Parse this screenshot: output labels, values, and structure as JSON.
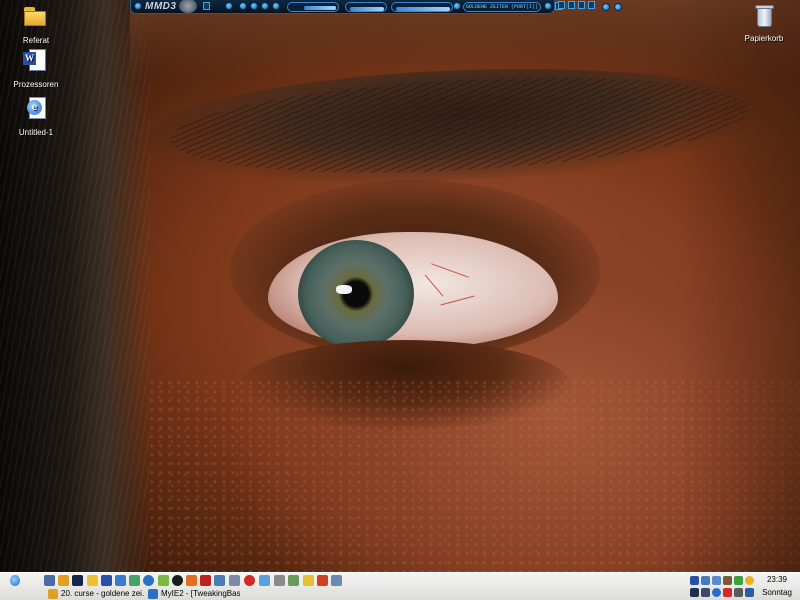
{
  "desktop": {
    "icons": [
      {
        "label": "Referat",
        "icon": "folder-icon"
      },
      {
        "label": "Prozessoren",
        "icon": "word-document-icon"
      },
      {
        "label": "Untitled-1",
        "icon": "html-document-icon"
      },
      {
        "label": "Papierkorb",
        "icon": "recycle-bin-icon"
      }
    ]
  },
  "media_player": {
    "logo": "MMD",
    "logo_number": "3",
    "track_display": "GOLDENE ZEITEN (PORT(I))",
    "accent_color": "#3d86c8"
  },
  "taskbar": {
    "start_icon": "apple-logo-icon",
    "tasks": [
      {
        "label": "20. curse - goldene zei...",
        "icon": "winamp-icon"
      },
      {
        "label": "MyIE2 - [TweakingBas...",
        "icon": "browser-icon"
      }
    ],
    "clock": {
      "time": "23:39",
      "day": "Sonntag"
    }
  }
}
